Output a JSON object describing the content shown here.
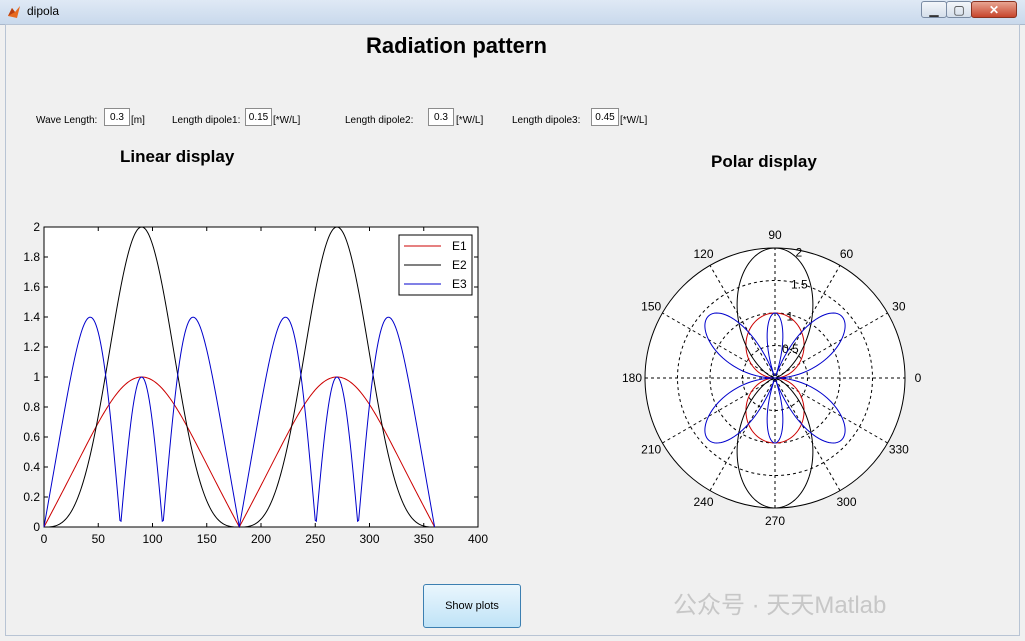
{
  "window": {
    "title": "dipola"
  },
  "figure": {
    "main_title": "Radiation pattern",
    "linear_title": "Linear display",
    "polar_title": "Polar display",
    "show_button": "Show plots"
  },
  "params": {
    "wave_length_label": "Wave Length:",
    "wave_length_value": "0.3",
    "wave_length_unit": "[m]",
    "dipole1_label": "Length dipole1:",
    "dipole1_value": "0.15",
    "dipole1_unit": "[*W/L]",
    "dipole2_label": "Length dipole2:",
    "dipole2_value": "0.3",
    "dipole2_unit": "[*W/L]",
    "dipole3_label": "Length dipole3:",
    "dipole3_value": "0.45",
    "dipole3_unit": "[*W/L]"
  },
  "watermark": "公众号 · 天天Matlab",
  "colors": {
    "E1": "#cc0000",
    "E2": "#000000",
    "E3": "#0000cc"
  },
  "chart_data": [
    {
      "type": "line",
      "xlabel": "",
      "ylabel": "",
      "xlim": [
        0,
        400
      ],
      "ylim": [
        0,
        2
      ],
      "xticks": [
        0,
        50,
        100,
        150,
        200,
        250,
        300,
        350,
        400
      ],
      "yticks": [
        0,
        0.2,
        0.4,
        0.6,
        0.8,
        1,
        1.2,
        1.4,
        1.6,
        1.8,
        2
      ],
      "legend_position": "top-right",
      "x_range": [
        0,
        360
      ],
      "series": [
        {
          "name": "E1",
          "x": [
            0,
            30,
            60,
            90,
            120,
            150,
            180,
            210,
            240,
            270,
            300,
            330,
            360
          ],
          "values": [
            0,
            0.5,
            0.87,
            1,
            0.87,
            0.5,
            0,
            0.5,
            0.87,
            1,
            0.87,
            0.5,
            0
          ]
        },
        {
          "name": "E2",
          "x": [
            0,
            30,
            60,
            90,
            120,
            150,
            180,
            210,
            240,
            270,
            300,
            330,
            360
          ],
          "values": [
            0,
            0.25,
            1.06,
            2,
            1.06,
            0.25,
            0,
            0.25,
            1.06,
            2,
            1.06,
            0.25,
            0
          ]
        },
        {
          "name": "E3",
          "x": [
            0,
            20,
            42,
            65,
            72,
            80,
            90,
            100,
            108,
            115,
            138,
            160,
            180
          ],
          "values": [
            0,
            0.95,
            1.4,
            0.5,
            0.12,
            0.55,
            1,
            0.55,
            0.12,
            0.5,
            1.4,
            0.95,
            0
          ]
        }
      ]
    },
    {
      "type": "polar",
      "rlim": [
        0,
        2
      ],
      "r_labels": [
        "0.5",
        "1",
        "1.5",
        "2"
      ],
      "angle_labels": [
        "0",
        "30",
        "60",
        "90",
        "120",
        "150",
        "180",
        "210",
        "240",
        "270",
        "300",
        "330"
      ],
      "series": [
        {
          "name": "E1",
          "shape": "|sin(theta)|",
          "max": 1
        },
        {
          "name": "E2",
          "shape": "2*sin(theta)^2",
          "max": 2
        },
        {
          "name": "E3",
          "shape": "three-lobe pattern",
          "lobe_peaks_deg": [
            42,
            90,
            138
          ],
          "lobe_peak_values": [
            1.4,
            1,
            1.4
          ]
        }
      ]
    }
  ]
}
